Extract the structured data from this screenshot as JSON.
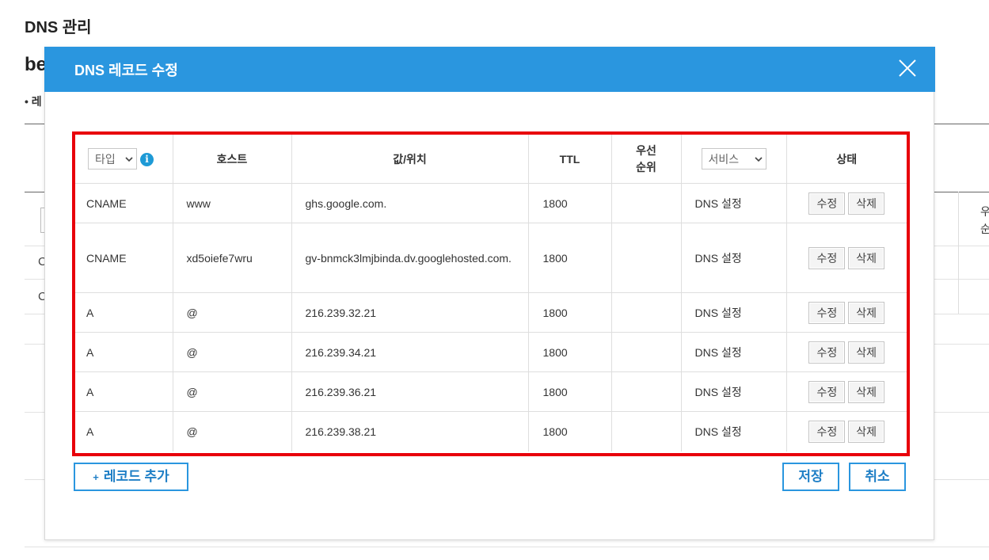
{
  "page": {
    "title": "DNS 관리",
    "domain_partial": "be",
    "bullet_partial": "• 레"
  },
  "background_rows": [
    "C",
    "C"
  ],
  "background_right_header": [
    "우",
    "순"
  ],
  "modal": {
    "title": "DNS 레코드 수정",
    "close_icon": "close-icon",
    "columns": {
      "type": "타입",
      "host": "호스트",
      "value": "값/위치",
      "ttl": "TTL",
      "priority_line1": "우선",
      "priority_line2": "순위",
      "service": "서비스",
      "status": "상태"
    },
    "records": [
      {
        "type": "CNAME",
        "host": "www",
        "value": "ghs.google.com.",
        "ttl": "1800",
        "priority": "",
        "service": "DNS 설정",
        "edit": "수정",
        "delete": "삭제"
      },
      {
        "type": "CNAME",
        "host": "xd5oiefe7wru",
        "value": "gv-bnmck3lmjbinda.dv.googlehosted.com.",
        "ttl": "1800",
        "priority": "",
        "service": "DNS 설정",
        "edit": "수정",
        "delete": "삭제"
      },
      {
        "type": "A",
        "host": "@",
        "value": "216.239.32.21",
        "ttl": "1800",
        "priority": "",
        "service": "DNS 설정",
        "edit": "수정",
        "delete": "삭제"
      },
      {
        "type": "A",
        "host": "@",
        "value": "216.239.34.21",
        "ttl": "1800",
        "priority": "",
        "service": "DNS 설정",
        "edit": "수정",
        "delete": "삭제"
      },
      {
        "type": "A",
        "host": "@",
        "value": "216.239.36.21",
        "ttl": "1800",
        "priority": "",
        "service": "DNS 설정",
        "edit": "수정",
        "delete": "삭제"
      },
      {
        "type": "A",
        "host": "@",
        "value": "216.239.38.21",
        "ttl": "1800",
        "priority": "",
        "service": "DNS 설정",
        "edit": "수정",
        "delete": "삭제"
      }
    ],
    "add_record_plus": "+",
    "add_record_label": "레코드 추가",
    "save_label": "저장",
    "cancel_label": "취소"
  },
  "colors": {
    "header_blue": "#2a96df",
    "highlight_red": "#e8000b",
    "info_icon": "#1e9ad6"
  }
}
